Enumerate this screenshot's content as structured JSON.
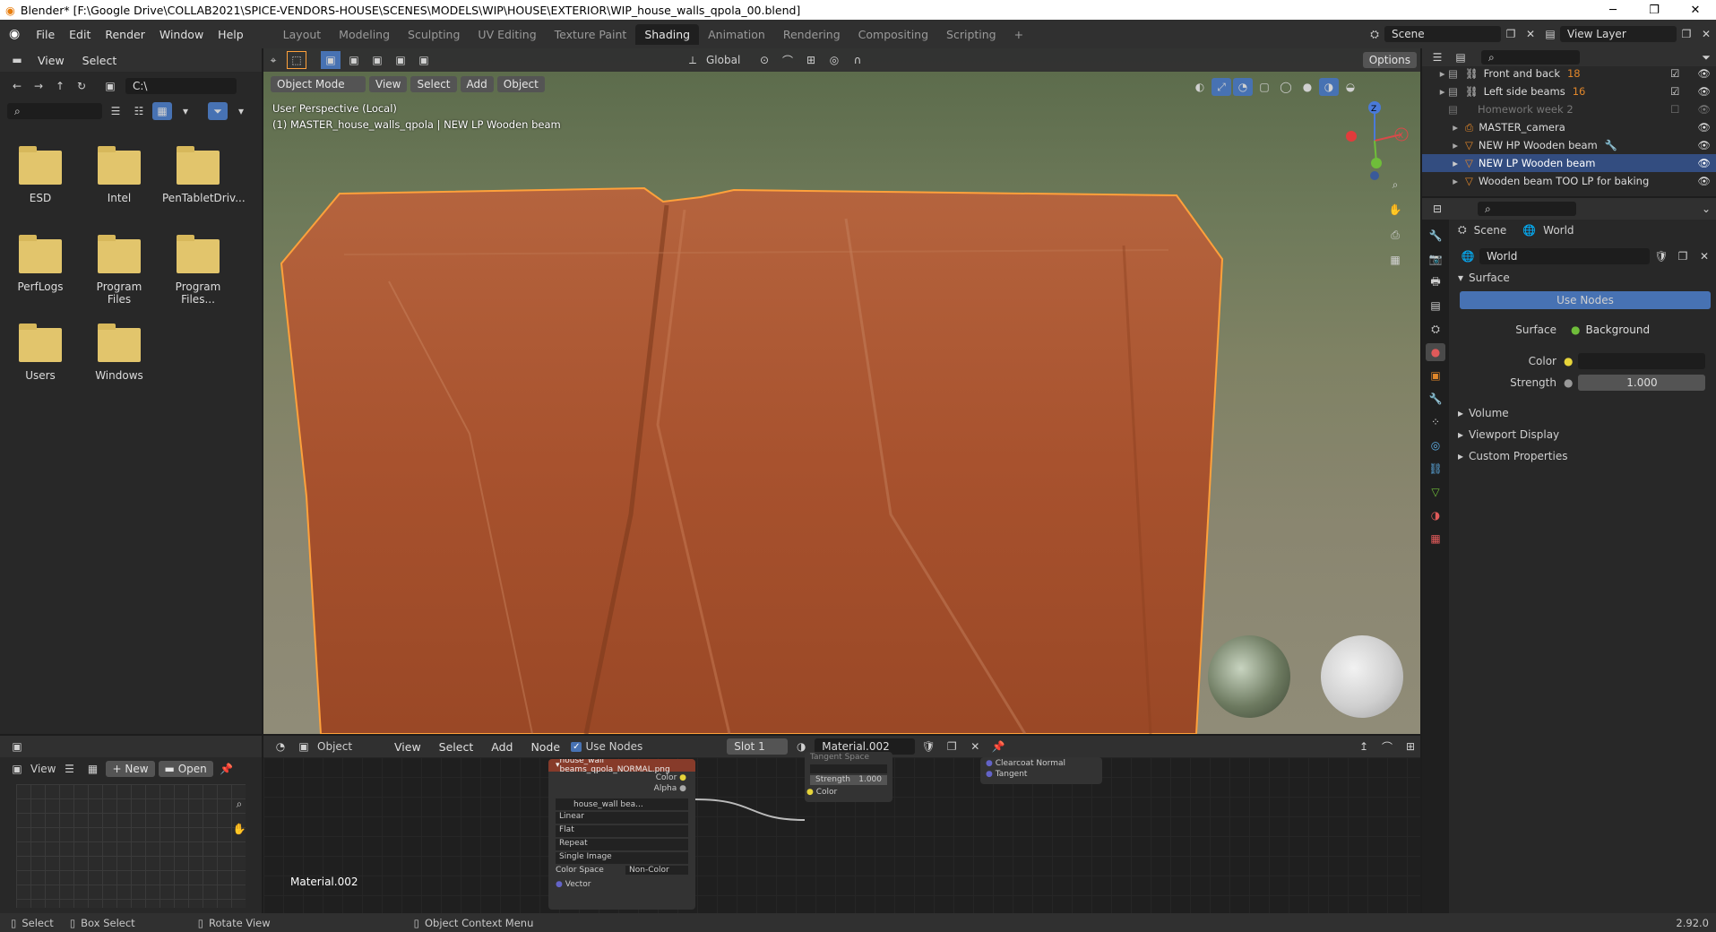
{
  "titlebar": {
    "title": "Blender* [F:\\Google Drive\\COLLAB2021\\SPICE-VENDORS-HOUSE\\SCENES\\MODELS\\WIP\\HOUSE\\EXTERIOR\\WIP_house_walls_qpola_00.blend]"
  },
  "menu": [
    "File",
    "Edit",
    "Render",
    "Window",
    "Help"
  ],
  "workspaces": [
    "Layout",
    "Modeling",
    "Sculpting",
    "UV Editing",
    "Texture Paint",
    "Shading",
    "Animation",
    "Rendering",
    "Compositing",
    "Scripting"
  ],
  "active_workspace": "Shading",
  "scene_label": "Scene",
  "view_layer_label": "View Layer",
  "filebrowser": {
    "view": "View",
    "select": "Select",
    "path": "C:\\",
    "folders": [
      "ESD",
      "Intel",
      "PenTabletDriv...",
      "PerfLogs",
      "Program Files",
      "Program Files...",
      "Users",
      "Windows"
    ]
  },
  "viewport": {
    "transform": "Global",
    "options": "Options",
    "mode": "Object Mode",
    "menu": [
      "View",
      "Select",
      "Add",
      "Object"
    ],
    "overlay_line1": "User Perspective (Local)",
    "overlay_line2": "(1) MASTER_house_walls_qpola | NEW LP Wooden beam"
  },
  "outliner": {
    "items": [
      {
        "name": "Front and back",
        "sel": false
      },
      {
        "name": "Left side beams",
        "sel": false
      },
      {
        "name": "Homework week 2",
        "sel": false
      },
      {
        "name": "MASTER_camera",
        "sel": false
      },
      {
        "name": "NEW HP Wooden beam",
        "sel": false
      },
      {
        "name": "NEW LP Wooden beam",
        "sel": true
      },
      {
        "name": "Wooden beam TOO LP for baking",
        "sel": false
      }
    ],
    "badges": [
      "18",
      "16"
    ]
  },
  "properties": {
    "breadcrumb_scene": "Scene",
    "breadcrumb_world": "World",
    "world_name": "World",
    "surface_panel": "Surface",
    "use_nodes": "Use Nodes",
    "surface_label": "Surface",
    "surface_value": "Background",
    "color_label": "Color",
    "strength_label": "Strength",
    "strength_value": "1.000",
    "panels": [
      "Volume",
      "Viewport Display",
      "Custom Properties"
    ]
  },
  "imgeditor": {
    "view": "View",
    "new": "New",
    "open": "Open"
  },
  "nodeeditor": {
    "object": "Object",
    "menu": [
      "View",
      "Select",
      "Add",
      "Node"
    ],
    "use_nodes": "Use Nodes",
    "slot": "Slot 1",
    "material": "Material.002",
    "material_label": "Material.002",
    "image_node": {
      "title": "house_wall beams_qpola_NORMAL.png",
      "out_color": "Color",
      "out_alpha": "Alpha",
      "image": "house_wall bea...",
      "interp": "Linear",
      "proj": "Flat",
      "ext": "Repeat",
      "source": "Single Image",
      "cs_label": "Color Space",
      "cs_value": "Non-Color",
      "in_vector": "Vector"
    },
    "normal_node": {
      "space": "Tangent Space",
      "strength_label": "Strength",
      "strength_value": "1.000",
      "in_color": "Color"
    },
    "bsdf_node": {
      "clearcoat": "Clearcoat Normal",
      "tangent": "Tangent"
    }
  },
  "statusbar": {
    "select": "Select",
    "box_select": "Box Select",
    "rotate": "Rotate View",
    "context": "Object Context Menu",
    "version": "2.92.0"
  },
  "colors": {
    "accent": "#4772b3",
    "selected": "#334d80",
    "outline": "#ffa13b",
    "beam": "#a8522e"
  }
}
